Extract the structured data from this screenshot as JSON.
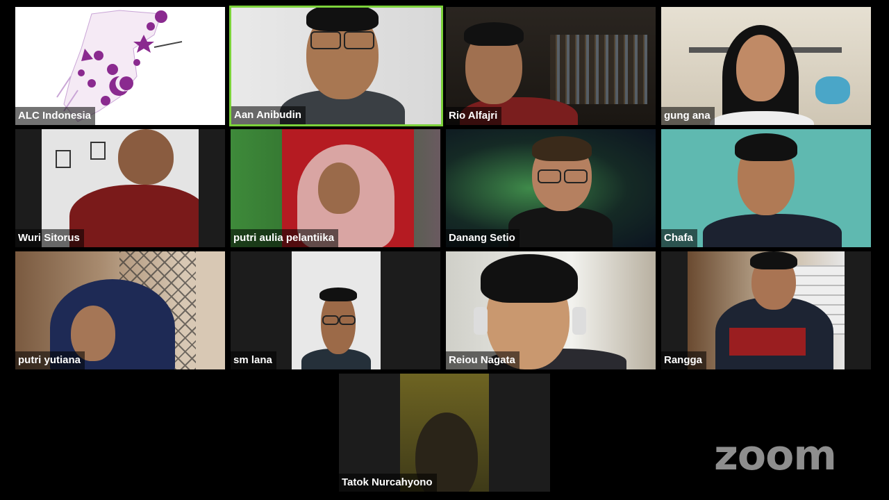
{
  "participants": [
    {
      "name": "ALC Indonesia"
    },
    {
      "name": "Aan Anibudin",
      "active": true
    },
    {
      "name": "Rio Alfajri"
    },
    {
      "name": "gung ana"
    },
    {
      "name": "Wuri Sitorus"
    },
    {
      "name": "putri aulia pelantiika"
    },
    {
      "name": "Danang Setio"
    },
    {
      "name": "Chafa"
    },
    {
      "name": "putri yutiana"
    },
    {
      "name": "sm lana"
    },
    {
      "name": "Reiou Nagata"
    },
    {
      "name": "Rangga"
    },
    {
      "name": "Tatok Nurcahyono"
    }
  ],
  "brand": {
    "logo_text": "zoom"
  },
  "colors": {
    "active_speaker_border": "#7cd23a",
    "logo": "#8e8e8e"
  }
}
